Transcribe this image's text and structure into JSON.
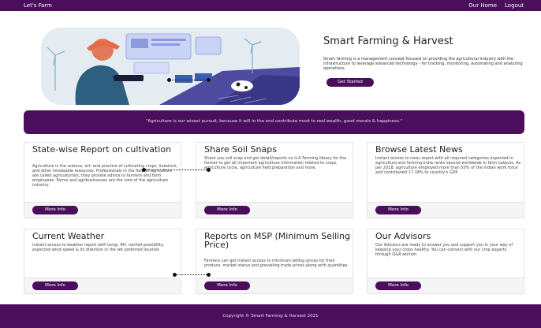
{
  "header": {
    "brand": "Let's Farm",
    "nav": [
      "Our Home",
      "Logout"
    ]
  },
  "hero": {
    "image_alt": "farmer-with-tablet-illustration",
    "title": "Smart Farming & Harvest",
    "description": "Smart farming is a management concept focused on providing the agricultural industry with the infrastructure to leverage advanced technology - for tracking, monitoring, automating and analyzing operations.",
    "button": "Get Started"
  },
  "quote": "\"Agriculture is our wisest pursuit, because it will in the end contribute most to real wealth, good morals & happiness.\"",
  "cards": [
    {
      "title": "State-wise Report on cultivation",
      "text": "Agriculture is the science, art, and practice of cultivating crops, livestock, and other renewable resources. Professionals in the field of agriculture are called agriculturists, they provide advice to farmers and farm employees. Farms and agribusinesses are the core of the agriculture industry.",
      "button": "More Info"
    },
    {
      "title": "Share Soil Snaps",
      "text": "Share you soil snap and get detail/reports on it.A Farming library for the farmer to get all important agriculture information related to crops, agriculture cycle, agriculture field preparation and more.",
      "button": "More Info"
    },
    {
      "title": "Browse Latest News",
      "text": "Instant access to news report with all required categories expected in agriculture and farming.India ranks second worldwide in farm outputs. As per 2018, agriculture employed more than 50% of the Indian work force and contributed 17-18% to country's GDP.",
      "button": "More Info"
    },
    {
      "title": "Current Weather",
      "text": "Instant access to weather report with temp, RH, rainfall possibility, expected wind speed & its direction in the set preferred location",
      "button": "More Info"
    },
    {
      "title": "Reports on MSP (Minimum Selling Price)",
      "text": "Farmers can get instant access to minimum selling prices for their produce, market status and prevailing trade prices along with quantities.",
      "button": "More Info"
    },
    {
      "title": "Our Advisors",
      "text": "Our Advisors are ready to answer you and support you in your way of keeping your crops healthy. You can connect with our crop experts through Q&A section",
      "button": "More Info"
    }
  ],
  "footer": {
    "copyright": "Copyright © Smart Farming & Harvest 2021"
  },
  "colors": {
    "primary": "#4a0e5c",
    "card_border": "#e4e4e4",
    "card_footer": "#f5f5f5"
  }
}
